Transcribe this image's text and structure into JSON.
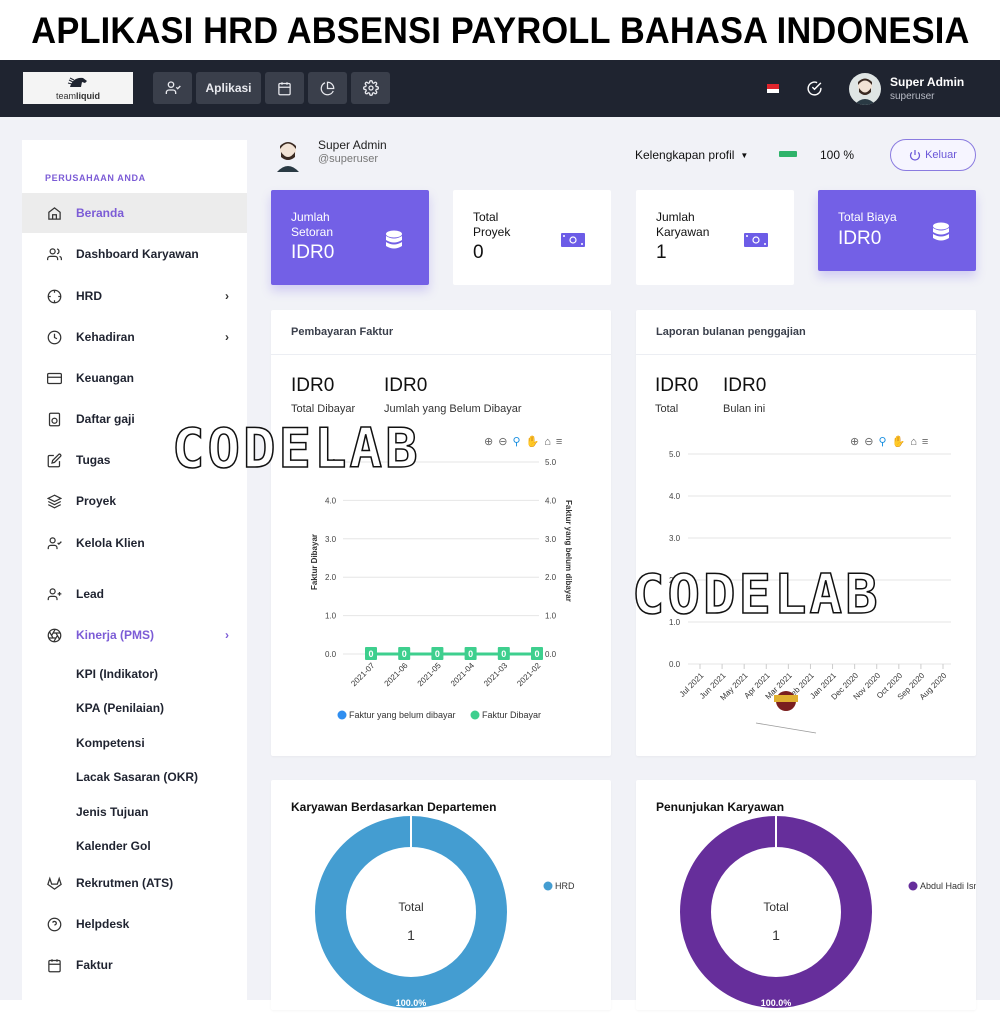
{
  "banner": {
    "title": "APLIKASI HRD ABSENSI PAYROLL BAHASA INDONESIA"
  },
  "topbar": {
    "logo_text_light": "team",
    "logo_text_bold": "liquid",
    "buttons": [
      {
        "icon": "user-check-icon"
      },
      {
        "label": "Aplikasi"
      },
      {
        "icon": "calendar-icon"
      },
      {
        "icon": "pie-chart-icon"
      },
      {
        "icon": "gear-icon"
      }
    ],
    "user": {
      "name": "Super Admin",
      "username": "superuser"
    }
  },
  "sidebar": {
    "section": "PERUSAHAAN ANDA",
    "items": [
      {
        "label": "Beranda",
        "icon": "home-icon",
        "active": true
      },
      {
        "label": "Dashboard Karyawan",
        "icon": "users-icon"
      },
      {
        "label": "HRD",
        "icon": "crosshair-icon",
        "chevron": true
      },
      {
        "label": "Kehadiran",
        "icon": "clock-icon",
        "chevron": true
      },
      {
        "label": "Keuangan",
        "icon": "credit-card-icon"
      },
      {
        "label": "Daftar gaji",
        "icon": "payroll-icon"
      },
      {
        "label": "Tugas",
        "icon": "edit-icon"
      },
      {
        "label": "Proyek",
        "icon": "layers-icon"
      },
      {
        "label": "Kelola Klien",
        "icon": "user-check-icon"
      },
      {
        "label": "Lead",
        "icon": "user-plus-icon"
      },
      {
        "label": "Kinerja (PMS)",
        "icon": "aperture-icon",
        "chevron": true,
        "open": true
      },
      {
        "label": "Rekrutmen (ATS)",
        "icon": "gitlab-icon"
      },
      {
        "label": "Helpdesk",
        "icon": "help-circle-icon"
      },
      {
        "label": "Faktur",
        "icon": "calendar-icon"
      }
    ],
    "subitems": [
      "KPI (Indikator)",
      "KPA (Penilaian)",
      "Kompetensi",
      "Lacak Sasaran (OKR)",
      "Jenis Tujuan",
      "Kalender Gol"
    ]
  },
  "profile": {
    "name": "Super Admin",
    "handle": "@superuser",
    "completeness_label": "Kelengkapan profil",
    "completeness_value": "100 %",
    "completeness_fraction": 1.0,
    "logout_label": "Keluar"
  },
  "stats": [
    {
      "label": "Jumlah Setoran",
      "value": "IDR0",
      "style": "purple",
      "icon": "database-icon"
    },
    {
      "label": "Total Proyek",
      "value": "0",
      "style": "white",
      "icon": "money-icon"
    },
    {
      "label": "Jumlah Karyawan",
      "value": "1",
      "style": "white",
      "icon": "money-icon"
    },
    {
      "label": "Total Biaya",
      "value": "IDR0",
      "style": "purple",
      "icon": "database-icon"
    }
  ],
  "invoice_panel": {
    "title": "Pembayaran Faktur",
    "total_paid_value": "IDR0",
    "total_paid_label": "Total Dibayar",
    "unpaid_value": "IDR0",
    "unpaid_label": "Jumlah yang Belum Dibayar"
  },
  "payroll_panel": {
    "title": "Laporan bulanan penggajian",
    "total_value": "IDR0",
    "total_label": "Total",
    "month_value": "IDR0",
    "month_label": "Bulan ini"
  },
  "dept_panel": {
    "title": "Karyawan Berdasarkan Departemen"
  },
  "assign_panel": {
    "title": "Penunjukan Karyawan"
  },
  "watermark": "CODELAB",
  "colors": {
    "accent": "#7360e6",
    "sidebar_accent": "#7c5cd6",
    "green": "#3ecf8e",
    "blue_dot": "#2f8ef0",
    "donut_blue": "#449dd1",
    "donut_purple": "#662e9b",
    "topbar": "#1f2430"
  },
  "chart_data": [
    {
      "type": "line",
      "title": "Pembayaran Faktur",
      "categories": [
        "2021-07",
        "2021-06",
        "2021-05",
        "2021-04",
        "2021-03",
        "2021-02"
      ],
      "series": [
        {
          "name": "Faktur yang belum dibayar",
          "values": [
            0,
            0,
            0,
            0,
            0,
            0
          ],
          "axis": "right"
        },
        {
          "name": "Faktur Dibayar",
          "values": [
            0,
            0,
            0,
            0,
            0,
            0
          ],
          "axis": "left",
          "data_labels": true
        }
      ],
      "ylabel": "Faktur Dibayar",
      "y2label": "Faktur yang belum dibayar",
      "ylim": [
        0,
        5
      ],
      "yticks": [
        "0.0",
        "1.0",
        "2.0",
        "3.0",
        "4.0",
        "5.0"
      ],
      "legend": "bottom",
      "grid": true
    },
    {
      "type": "line",
      "title": "Laporan bulanan penggajian",
      "categories": [
        "Jul 2021",
        "Jun 2021",
        "May 2021",
        "Apr 2021",
        "Mar 2021",
        "Feb 2021",
        "Jan 2021",
        "Dec 2020",
        "Nov 2020",
        "Oct 2020",
        "Sep 2020",
        "Aug 2020"
      ],
      "series": [],
      "ylim": [
        0,
        5
      ],
      "yticks": [
        "0.0",
        "1.0",
        "2.0",
        "3.0",
        "4.0",
        "5.0"
      ],
      "grid": true
    },
    {
      "type": "pie",
      "title": "Karyawan Berdasarkan Departemen",
      "labels": [
        "HRD"
      ],
      "values": [
        1
      ],
      "center_label": "Total",
      "center_value": "1",
      "slice_label": "100.0%",
      "legend": "right"
    },
    {
      "type": "pie",
      "title": "Penunjukan Karyawan",
      "labels": [
        "Abdul Hadi Ismail"
      ],
      "values": [
        1
      ],
      "center_label": "Total",
      "center_value": "1",
      "slice_label": "100.0%",
      "legend": "right"
    }
  ]
}
